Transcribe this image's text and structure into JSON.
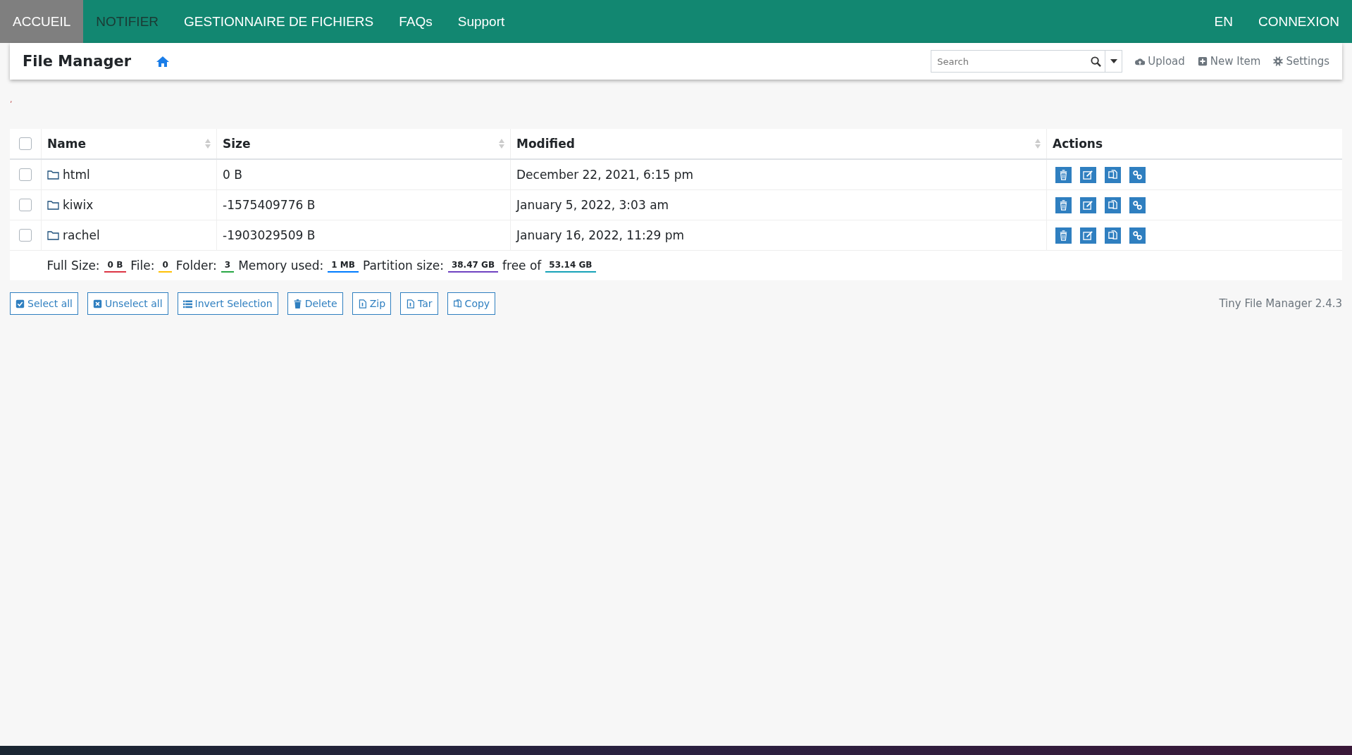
{
  "nav": {
    "items": [
      {
        "label": "ACCUEIL",
        "selected": true,
        "hover": false
      },
      {
        "label": "NOTIFIER",
        "selected": false,
        "hover": true
      },
      {
        "label": "GESTIONNAIRE DE FICHIERS",
        "selected": false,
        "hover": false
      },
      {
        "label": "FAQs",
        "selected": false,
        "hover": false
      },
      {
        "label": "Support",
        "selected": false,
        "hover": false
      }
    ],
    "right": [
      "EN",
      "CONNEXION"
    ]
  },
  "toolbar": {
    "title": "File Manager",
    "search": {
      "placeholder": "Search"
    },
    "actions": [
      {
        "kind": "upload",
        "label": "Upload"
      },
      {
        "kind": "new",
        "label": "New Item"
      },
      {
        "kind": "settings",
        "label": "Settings"
      }
    ]
  },
  "breadcrumb_mark": ",",
  "table": {
    "all_checked": false,
    "columns": [
      {
        "label": "Name",
        "sortable": true
      },
      {
        "label": "Size",
        "sortable": true
      },
      {
        "label": "Modified",
        "sortable": true
      },
      {
        "label": "Actions",
        "sortable": false
      }
    ],
    "rows": [
      {
        "checked": false,
        "name": "html",
        "size": "0 B",
        "modified": "December 22, 2021, 6:15 pm"
      },
      {
        "checked": false,
        "name": "kiwix",
        "size": "-1575409776 B",
        "modified": "January 5, 2022, 3:03 am"
      },
      {
        "checked": false,
        "name": "rachel",
        "size": "-1903029509 B",
        "modified": "January 16, 2022, 11:29 pm"
      }
    ],
    "summary": [
      {
        "label": "Full Size:",
        "value": "0 B",
        "color": "#dc3545"
      },
      {
        "label": "File:",
        "value": "0",
        "color": "#ffc107"
      },
      {
        "label": "Folder:",
        "value": "3",
        "color": "#28a745"
      },
      {
        "label": "Memory used:",
        "value": "1 MB",
        "color": "#007bff"
      },
      {
        "label": "Partition size:",
        "value": "38.47 GB",
        "color": "#6f42c1"
      },
      {
        "label": "free of",
        "value": "53.14 GB",
        "color": "#17a2b8"
      }
    ]
  },
  "buttons": [
    {
      "kind": "check",
      "label": "Select all"
    },
    {
      "kind": "uncheck",
      "label": "Unselect all"
    },
    {
      "kind": "list",
      "label": "Invert Selection"
    },
    {
      "kind": "trash",
      "label": "Delete"
    },
    {
      "kind": "file",
      "label": "Zip"
    },
    {
      "kind": "file",
      "label": "Tar"
    },
    {
      "kind": "copy",
      "label": "Copy"
    }
  ],
  "version": "Tiny File Manager 2.4.3"
}
